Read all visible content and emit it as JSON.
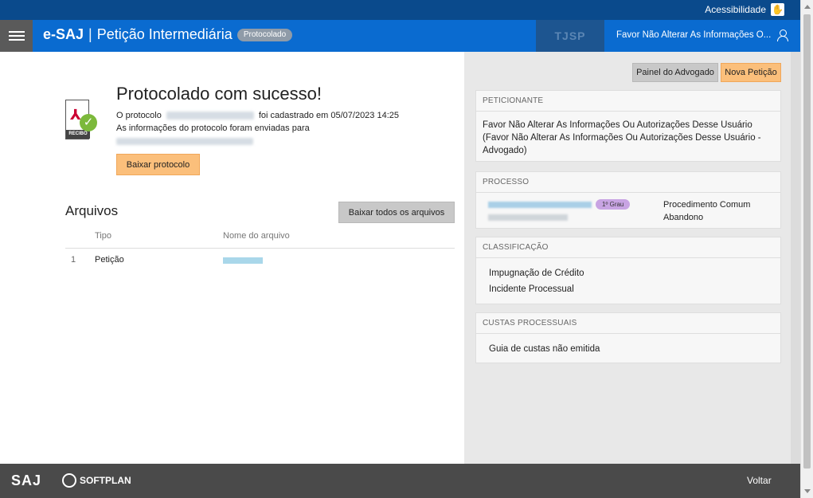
{
  "topbar": {
    "accessibility_label": "Acessibilidade"
  },
  "header": {
    "brand": "e-SAJ",
    "separator": "|",
    "subtitle": "Petição Intermediária",
    "status_badge": "Protocolado",
    "user_name": "Favor Não Alterar As Informações O..."
  },
  "receipt": {
    "label": "RECIBO"
  },
  "success": {
    "title": "Protocolado com sucesso!",
    "protocol_prefix": "O protocolo",
    "protocol_suffix": "foi cadastrado em 05/07/2023 14:25",
    "info_text": "As informações do protocolo foram enviadas para",
    "download_button": "Baixar protocolo"
  },
  "files": {
    "title": "Arquivos",
    "download_all_button": "Baixar todos os arquivos",
    "columns": {
      "tipo": "Tipo",
      "nome": "Nome do arquivo"
    },
    "rows": [
      {
        "index": "1",
        "tipo": "Petição"
      }
    ]
  },
  "actions": {
    "painel_button": "Painel do Advogado",
    "nova_button": "Nova Petição"
  },
  "peticionante": {
    "title": "PETICIONANTE",
    "name": "Favor Não Alterar As Informações Ou Autorizações Desse Usuário (Favor Não Alterar As Informações Ou Autorizações Desse Usuário - Advogado)"
  },
  "processo": {
    "title": "PROCESSO",
    "grau_badge": "1º Grau",
    "classe": "Procedimento Comum",
    "situacao": "Abandono"
  },
  "classificacao": {
    "title": "CLASSIFICAÇÃO",
    "items": [
      "Impugnação de Crédito",
      "Incidente Processual"
    ]
  },
  "custas": {
    "title": "CUSTAS PROCESSUAIS",
    "status": "Guia de custas não emitida"
  },
  "footer": {
    "saj_logo": "SAJ",
    "softplan_logo": "SOFTPLAN",
    "voltar": "Voltar"
  }
}
